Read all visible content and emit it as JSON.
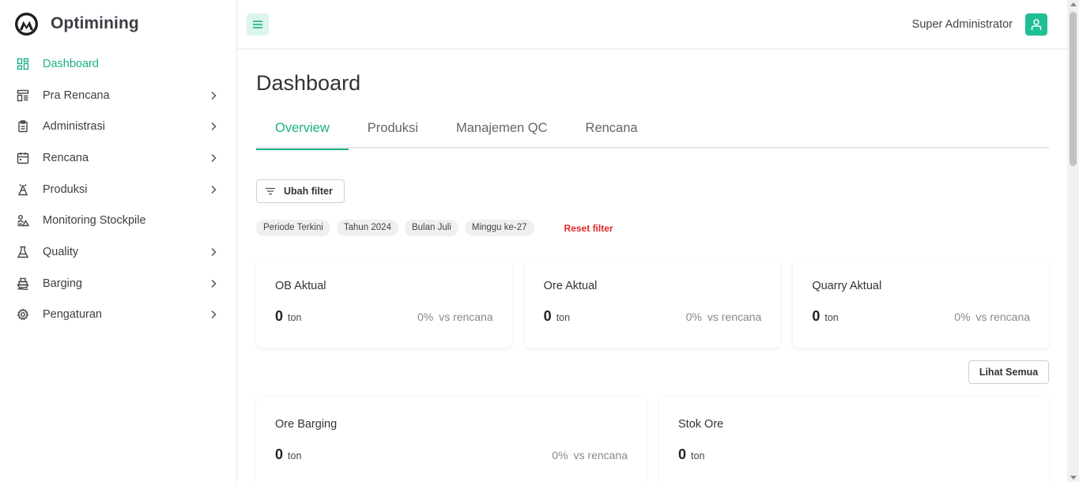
{
  "brand": {
    "name": "Optimining",
    "logo_icon": "mountain-logo-icon"
  },
  "sidebar": {
    "items": [
      {
        "label": "Dashboard",
        "icon": "dashboard-icon",
        "active": true,
        "has_children": false
      },
      {
        "label": "Pra Rencana",
        "icon": "layout-list-icon",
        "active": false,
        "has_children": true
      },
      {
        "label": "Administrasi",
        "icon": "clipboard-icon",
        "active": false,
        "has_children": true
      },
      {
        "label": "Rencana",
        "icon": "calendar-icon",
        "active": false,
        "has_children": true
      },
      {
        "label": "Produksi",
        "icon": "excavator-icon",
        "active": false,
        "has_children": true
      },
      {
        "label": "Monitoring Stockpile",
        "icon": "stockpile-icon",
        "active": false,
        "has_children": false
      },
      {
        "label": "Quality",
        "icon": "flask-icon",
        "active": false,
        "has_children": true
      },
      {
        "label": "Barging",
        "icon": "ship-icon",
        "active": false,
        "has_children": true
      },
      {
        "label": "Pengaturan",
        "icon": "gear-icon",
        "active": false,
        "has_children": true
      }
    ]
  },
  "topbar": {
    "user_name": "Super Administrator",
    "user_icon": "user-icon",
    "menu_icon": "hamburger-icon"
  },
  "page": {
    "title": "Dashboard",
    "tabs": [
      {
        "label": "Overview",
        "active": true
      },
      {
        "label": "Produksi",
        "active": false
      },
      {
        "label": "Manajemen QC",
        "active": false
      },
      {
        "label": "Rencana",
        "active": false
      }
    ],
    "filter_button": "Ubah filter",
    "filter_chips": [
      "Periode Terkini",
      "Tahun 2024",
      "Bulan Juli",
      "Minggu ke-27"
    ],
    "reset_filter": "Reset filter",
    "lihat_semua": "Lihat Semua"
  },
  "cards_top": [
    {
      "title": "OB Aktual",
      "value": "0",
      "unit": "ton",
      "pct": "0%",
      "vs": "vs rencana"
    },
    {
      "title": "Ore Aktual",
      "value": "0",
      "unit": "ton",
      "pct": "0%",
      "vs": "vs rencana"
    },
    {
      "title": "Quarry Aktual",
      "value": "0",
      "unit": "ton",
      "pct": "0%",
      "vs": "vs rencana"
    }
  ],
  "cards_bottom": [
    {
      "title": "Ore Barging",
      "value": "0",
      "unit": "ton",
      "pct": "0%",
      "vs": "vs rencana"
    },
    {
      "title": "Stok Ore",
      "value": "0",
      "unit": "ton"
    }
  ],
  "colors": {
    "accent": "#1dae8a",
    "reset": "#e0262b",
    "avatar": "#1fbf95",
    "menu_bg": "#dcf5ec"
  }
}
